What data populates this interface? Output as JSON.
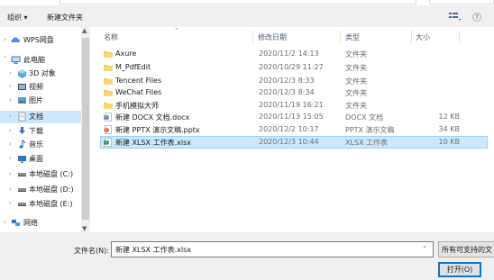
{
  "toolbar": {
    "organize_label": "组织 ▾",
    "new_folder_label": "新建文件夹",
    "help_label": "?"
  },
  "nav": {
    "items": [
      {
        "label": "WPS网盘",
        "icon": "cloud-icon"
      },
      {
        "label": "此电脑",
        "icon": "computer-icon"
      },
      {
        "label": "3D 对象",
        "icon": "3d-objects-icon"
      },
      {
        "label": "视频",
        "icon": "video-icon"
      },
      {
        "label": "图片",
        "icon": "pictures-icon"
      },
      {
        "label": "文档",
        "icon": "documents-icon",
        "selected": true
      },
      {
        "label": "下载",
        "icon": "download-icon"
      },
      {
        "label": "音乐",
        "icon": "music-icon"
      },
      {
        "label": "桌面",
        "icon": "desktop-icon"
      },
      {
        "label": "本地磁盘 (C:)",
        "icon": "drive-icon"
      },
      {
        "label": "本地磁盘 (D:)",
        "icon": "drive-icon"
      },
      {
        "label": "本地磁盘 (E:)",
        "icon": "drive-icon"
      },
      {
        "label": "网络",
        "icon": "network-icon"
      }
    ]
  },
  "list": {
    "columns": {
      "name": "名称",
      "modified": "修改日期",
      "type": "类型",
      "size": "大小"
    },
    "rows": [
      {
        "name": "Axure",
        "modified": "2020/11/2 14:13",
        "type": "文件夹",
        "size": "",
        "icon": "folder-icon"
      },
      {
        "name": "M_PdfEdit",
        "modified": "2020/10/29 11:27",
        "type": "文件夹",
        "size": "",
        "icon": "folder-icon"
      },
      {
        "name": "Tencent Files",
        "modified": "2020/12/3 8:33",
        "type": "文件夹",
        "size": "",
        "icon": "folder-icon"
      },
      {
        "name": "WeChat Files",
        "modified": "2020/12/3 8:34",
        "type": "文件夹",
        "size": "",
        "icon": "folder-icon"
      },
      {
        "name": "手机模拟大师",
        "modified": "2020/11/19 16:21",
        "type": "文件夹",
        "size": "",
        "icon": "folder-icon"
      },
      {
        "name": "新建 DOCX 文档.docx",
        "modified": "2020/11/13 15:05",
        "type": "DOCX 文档",
        "size": "12 KB",
        "icon": "docx-file-icon"
      },
      {
        "name": "新建 PPTX 演示文稿.pptx",
        "modified": "2020/12/2 10:17",
        "type": "PPTX 演示文稿",
        "size": "34 KB",
        "icon": "pptx-file-icon"
      },
      {
        "name": "新建 XLSX 工作表.xlsx",
        "modified": "2020/12/3 10:44",
        "type": "XLSX 工作表",
        "size": "10 KB",
        "icon": "xlsx-file-icon",
        "selected": true
      }
    ]
  },
  "form": {
    "filename_label": "文件名(N):",
    "filename_value": "新建 XLSX 工作表.xlsx",
    "filetype_value": "所有可支持的文",
    "open_label": "打开(O)"
  },
  "colors": {
    "selection_bg": "#cce8ff",
    "selection_border": "#99d1ff",
    "chrome_bg": "#f0f0f0",
    "folder": "#f3c94a",
    "docx": "#2b5797",
    "pptx": "#d24726",
    "xlsx": "#1f7244",
    "accent": "#0078d7"
  }
}
